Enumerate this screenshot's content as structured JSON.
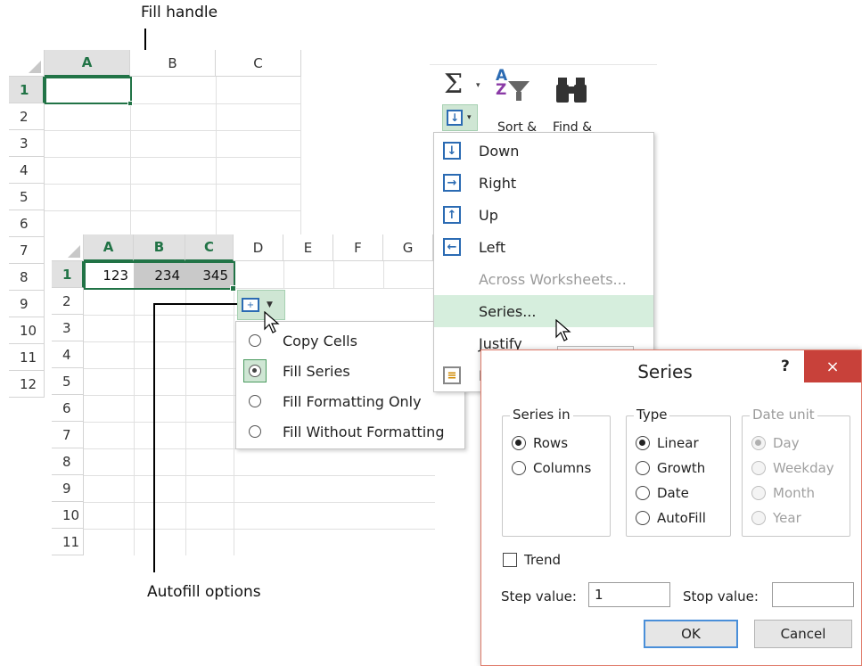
{
  "callouts": {
    "fill_handle": "Fill handle",
    "autofill_options": "Autofill options"
  },
  "sheet1": {
    "columns": [
      "A",
      "B",
      "C"
    ],
    "rows": [
      "1",
      "2",
      "3",
      "4",
      "5",
      "6",
      "7",
      "8",
      "9",
      "10",
      "11",
      "12"
    ],
    "selected_column": "A",
    "selected_row": "1"
  },
  "sheet2": {
    "columns": [
      "A",
      "B",
      "C",
      "D",
      "E",
      "F",
      "G"
    ],
    "rows": [
      "1",
      "2",
      "3",
      "4",
      "5",
      "6",
      "7",
      "8",
      "9",
      "10",
      "11"
    ],
    "row1_values": [
      "123",
      "234",
      "345"
    ]
  },
  "ribbon": {
    "sigma": "Σ",
    "sort_label": "Sort &",
    "find_label": "Find &"
  },
  "fill_menu": {
    "items": [
      {
        "label": "Down",
        "icon": "fill-down-icon",
        "glyph": "↓"
      },
      {
        "label": "Right",
        "icon": "fill-right-icon",
        "glyph": "→"
      },
      {
        "label": "Up",
        "icon": "fill-up-icon",
        "glyph": "↑"
      },
      {
        "label": "Left",
        "icon": "fill-left-icon",
        "glyph": "←"
      },
      {
        "label": "Across Worksheets...",
        "disabled": true
      },
      {
        "label": "Series...",
        "highlighted": true
      },
      {
        "label": "Justify"
      },
      {
        "label": "F",
        "icon": "flash-fill-icon"
      }
    ]
  },
  "autofill_menu": {
    "items": [
      {
        "label": "Copy Cells",
        "selected": false
      },
      {
        "label": "Fill Series",
        "selected": true
      },
      {
        "label": "Fill Formatting Only",
        "selected": false
      },
      {
        "label": "Fill Without Formatting",
        "selected": false
      }
    ]
  },
  "series_dialog": {
    "title": "Series",
    "help": "?",
    "close": "×",
    "series_in": {
      "label": "Series in",
      "options": [
        {
          "label": "Rows",
          "selected": true
        },
        {
          "label": "Columns",
          "selected": false
        }
      ]
    },
    "type": {
      "label": "Type",
      "options": [
        {
          "label": "Linear",
          "selected": true
        },
        {
          "label": "Growth",
          "selected": false
        },
        {
          "label": "Date",
          "selected": false
        },
        {
          "label": "AutoFill",
          "selected": false
        }
      ]
    },
    "date_unit": {
      "label": "Date unit",
      "disabled": true,
      "options": [
        {
          "label": "Day",
          "selected": true
        },
        {
          "label": "Weekday",
          "selected": false
        },
        {
          "label": "Month",
          "selected": false
        },
        {
          "label": "Year",
          "selected": false
        }
      ]
    },
    "trend_label": "Trend",
    "step_label": "Step value:",
    "step_value": "1",
    "stop_label": "Stop value:",
    "stop_value": "",
    "ok": "OK",
    "cancel": "Cancel"
  },
  "colors": {
    "excel_green": "#217346",
    "selection_green": "#cfe6d4",
    "close_red": "#c8413a",
    "icon_blue": "#2b6bb3"
  }
}
